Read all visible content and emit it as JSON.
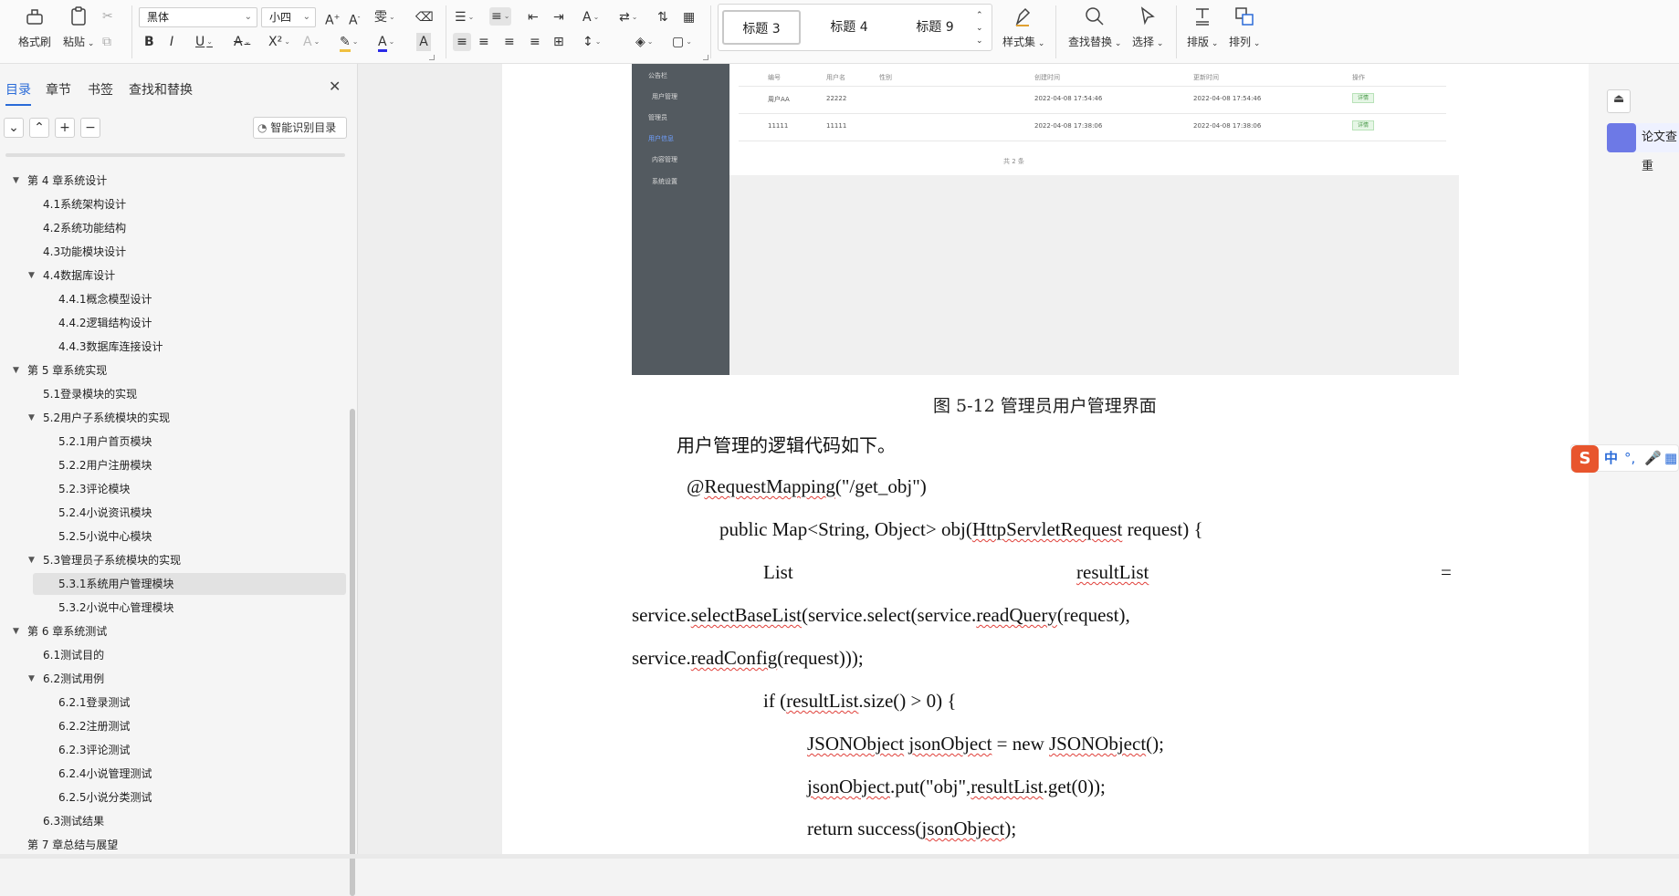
{
  "ribbon": {
    "format_painter": "格式刷",
    "paste": "粘贴",
    "font_name": "黑体",
    "font_size": "小四",
    "styles": [
      "标题 3",
      "标题 4",
      "标题 9"
    ],
    "style_set": "样式集",
    "find_replace": "查找替换",
    "select": "选择",
    "layout": "排版",
    "arrange": "排列"
  },
  "nav": {
    "tabs": [
      "目录",
      "章节",
      "书签",
      "查找和替换"
    ],
    "smart_toc": "智能识别目录",
    "toc": [
      {
        "label": "第 4 章系统设计",
        "level": 0,
        "expanded": true
      },
      {
        "label": "4.1系统架构设计",
        "level": 1
      },
      {
        "label": "4.2系统功能结构",
        "level": 1
      },
      {
        "label": "4.3功能模块设计",
        "level": 1
      },
      {
        "label": "4.4数据库设计",
        "level": 1,
        "expanded": true
      },
      {
        "label": "4.4.1概念模型设计",
        "level": 2
      },
      {
        "label": "4.4.2逻辑结构设计",
        "level": 2
      },
      {
        "label": "4.4.3数据库连接设计",
        "level": 2
      },
      {
        "label": "第 5 章系统实现",
        "level": 0,
        "expanded": true
      },
      {
        "label": "5.1登录模块的实现",
        "level": 1
      },
      {
        "label": "5.2用户子系统模块的实现",
        "level": 1,
        "expanded": true
      },
      {
        "label": "5.2.1用户首页模块",
        "level": 2
      },
      {
        "label": "5.2.2用户注册模块",
        "level": 2
      },
      {
        "label": "5.2.3评论模块",
        "level": 2
      },
      {
        "label": "5.2.4小说资讯模块",
        "level": 2
      },
      {
        "label": "5.2.5小说中心模块",
        "level": 2
      },
      {
        "label": "5.3管理员子系统模块的实现",
        "level": 1,
        "expanded": true
      },
      {
        "label": "5.3.1系统用户管理模块",
        "level": 2,
        "selected": true
      },
      {
        "label": "5.3.2小说中心管理模块",
        "level": 2
      },
      {
        "label": "第 6 章系统测试",
        "level": 0,
        "expanded": true
      },
      {
        "label": "6.1测试目的",
        "level": 1
      },
      {
        "label": "6.2测试用例",
        "level": 1,
        "expanded": true
      },
      {
        "label": "6.2.1登录测试",
        "level": 2
      },
      {
        "label": "6.2.2注册测试",
        "level": 2
      },
      {
        "label": "6.2.3评论测试",
        "level": 2
      },
      {
        "label": "6.2.4小说管理测试",
        "level": 2
      },
      {
        "label": "6.2.5小说分类测试",
        "level": 2
      },
      {
        "label": "6.3测试结果",
        "level": 1
      },
      {
        "label": "第 7 章总结与展望",
        "level": 0
      }
    ]
  },
  "figure": {
    "sidebar": [
      "公告栏",
      "用户管理",
      "管理员",
      "用户信息",
      "内容管理",
      "系统设置"
    ],
    "headers": [
      "编号",
      "用户名",
      "性别",
      "创建时间",
      "更新时间",
      "操作"
    ],
    "rows": [
      [
        "周户AA",
        "22222",
        "2022-04-08 17:54:46",
        "2022-04-08 17:54:46",
        "详情"
      ],
      [
        "11111",
        "11111",
        "2022-04-08 17:38:06",
        "2022-04-08 17:38:06",
        "详情"
      ]
    ],
    "pagination": "共 2 条"
  },
  "document": {
    "caption": "图 5-12 管理员用户管理界面",
    "intro": "用户管理的逻辑代码如下。"
  },
  "rightbar": {
    "paper_check": "论文查重",
    "ime_label": "中"
  }
}
